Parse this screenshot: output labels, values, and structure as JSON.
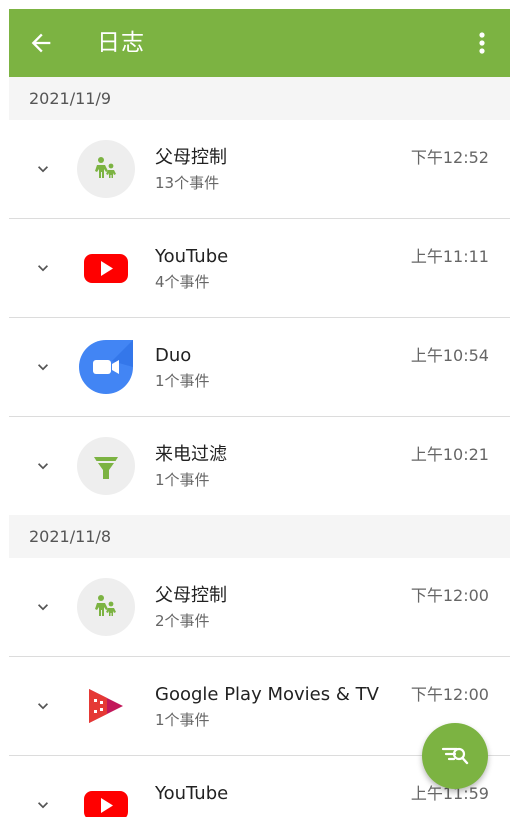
{
  "appbar": {
    "title": "日志",
    "back_icon": "arrow-left-icon",
    "menu_icon": "more-vert-icon",
    "color": "#7cb342"
  },
  "groups": [
    {
      "date": "2021/11/9",
      "entries": [
        {
          "name": "父母控制",
          "count": "13个事件",
          "time": "下午12:52",
          "icon": "parental-control-icon"
        },
        {
          "name": "YouTube",
          "count": "4个事件",
          "time": "上午11:11",
          "icon": "youtube-icon"
        },
        {
          "name": "Duo",
          "count": "1个事件",
          "time": "上午10:54",
          "icon": "duo-icon"
        },
        {
          "name": "来电过滤",
          "count": "1个事件",
          "time": "上午10:21",
          "icon": "call-filter-icon"
        }
      ]
    },
    {
      "date": "2021/11/8",
      "entries": [
        {
          "name": "父母控制",
          "count": "2个事件",
          "time": "下午12:00",
          "icon": "parental-control-icon"
        },
        {
          "name": "Google Play Movies & TV",
          "count": "1个事件",
          "time": "下午12:00",
          "icon": "play-movies-icon"
        },
        {
          "name": "YouTube",
          "count": "",
          "time": "上午11:59",
          "icon": "youtube-icon"
        }
      ]
    }
  ],
  "fab": {
    "icon": "filter-search-icon"
  }
}
